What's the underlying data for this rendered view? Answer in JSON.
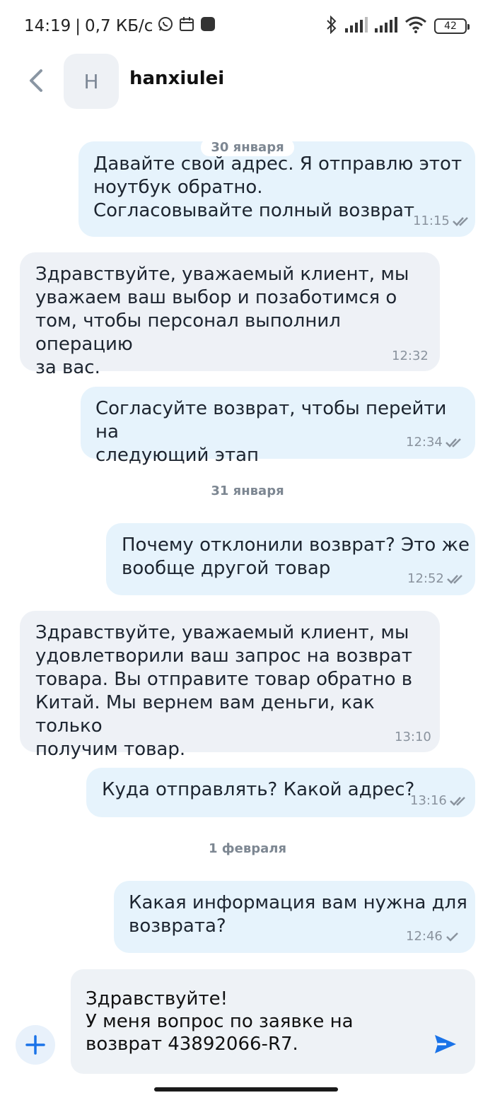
{
  "status_bar": {
    "time": "14:19",
    "network_speed": "0,7 КБ/с",
    "battery": "42",
    "icons": [
      "whatsapp-icon",
      "calendar-icon",
      "app-icon",
      "bluetooth-icon",
      "signal-icon",
      "signal-icon",
      "wifi-icon",
      "battery-icon"
    ]
  },
  "header": {
    "avatar_letter": "H",
    "contact_name": "hanxiulei"
  },
  "messages": [
    {
      "direction": "out",
      "text": "Давайте свой адрес. Я отправлю этот\nноутбук обратно.\nСогласовывайте полный возврат",
      "time": "11:15",
      "status": "read"
    },
    {
      "direction": "in",
      "text": "Здравствуйте, уважаемый клиент, мы\nуважаем ваш выбор и позаботимся о\nтом, чтобы персонал выполнил операцию\nза вас.",
      "time": "12:32"
    },
    {
      "direction": "out",
      "text": "Согласуйте возврат, чтобы перейти на\nследующий этап",
      "time": "12:34",
      "status": "read"
    },
    {
      "direction": "out",
      "text": "Почему отклонили возврат? Это же\nвообще другой товар",
      "time": "12:52",
      "status": "read"
    },
    {
      "direction": "in",
      "text": "Здравствуйте, уважаемый клиент, мы\nудовлетворили ваш запрос на возврат\nтовара. Вы отправите товар обратно в\nКитай. Мы вернем вам деньги, как только\nполучим товар.",
      "time": "13:10"
    },
    {
      "direction": "out",
      "text": "Куда отправлять? Какой адрес?",
      "time": "13:16",
      "status": "read"
    },
    {
      "direction": "out",
      "text": "Какая информация вам нужна для\nвозврата?",
      "time": "12:46",
      "status": "sent"
    }
  ],
  "date_separators": [
    "30 января",
    "31 января",
    "1 февраля"
  ],
  "composer": {
    "text": "Здравствуйте!\nУ меня вопрос по заявке на\nвозврат 43892066-R7."
  },
  "colors": {
    "outgoing_bubble": "#e6f3fc",
    "incoming_bubble": "#eef1f6",
    "accent": "#1a73e8"
  }
}
